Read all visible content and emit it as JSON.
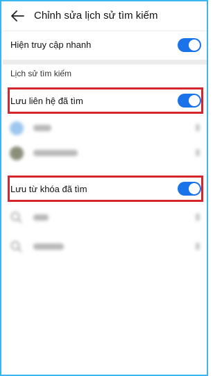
{
  "header": {
    "title": "Chỉnh sửa lịch sử tìm kiếm",
    "back_icon": "arrow-back-icon"
  },
  "settings": {
    "quick_access": {
      "label": "Hiện truy cập nhanh",
      "enabled": true
    }
  },
  "history": {
    "section_title": "Lịch sử tìm kiếm",
    "save_contacts": {
      "label": "Lưu liên hệ đã tìm",
      "enabled": true
    },
    "save_keywords": {
      "label": "Lưu từ khóa đã tìm",
      "enabled": true
    }
  },
  "colors": {
    "toggle_on": "#1a73e8",
    "highlight_border": "#d6262d",
    "frame_border": "#3bb5f0"
  }
}
